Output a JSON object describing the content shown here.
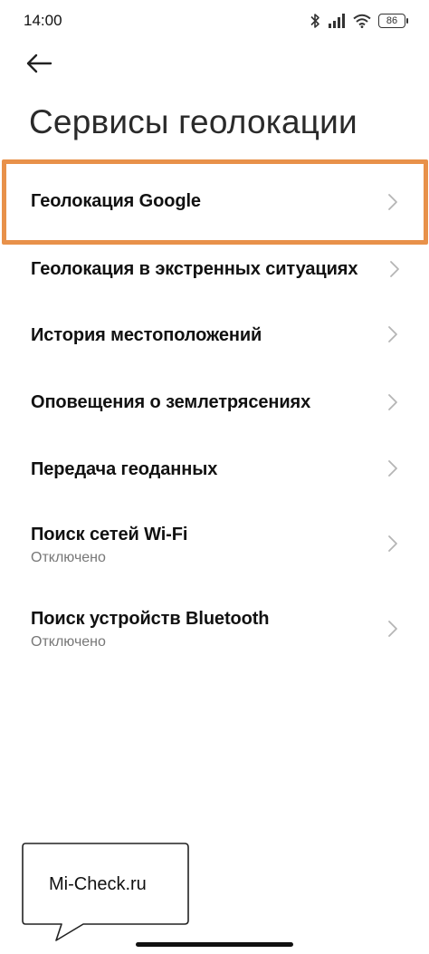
{
  "status_bar": {
    "time": "14:00",
    "battery": "86",
    "icons": [
      "bluetooth-icon",
      "signal-icon",
      "wifi-icon",
      "battery-icon"
    ]
  },
  "header": {
    "back_icon": "arrow-left-icon",
    "title": "Сервисы геолокации"
  },
  "items": [
    {
      "title": "Геолокация Google",
      "subtitle": ""
    },
    {
      "title": "Геолокация в экстренных ситуациях",
      "subtitle": ""
    },
    {
      "title": "История местоположений",
      "subtitle": ""
    },
    {
      "title": "Оповещения о землетрясениях",
      "subtitle": ""
    },
    {
      "title": "Передача геоданных",
      "subtitle": ""
    },
    {
      "title": "Поиск сетей Wi-Fi",
      "subtitle": "Отключено"
    },
    {
      "title": "Поиск устройств Bluetooth",
      "subtitle": "Отключено"
    }
  ],
  "highlight_color": "#e8914a",
  "watermark": {
    "text": "Mi-Check.ru"
  }
}
